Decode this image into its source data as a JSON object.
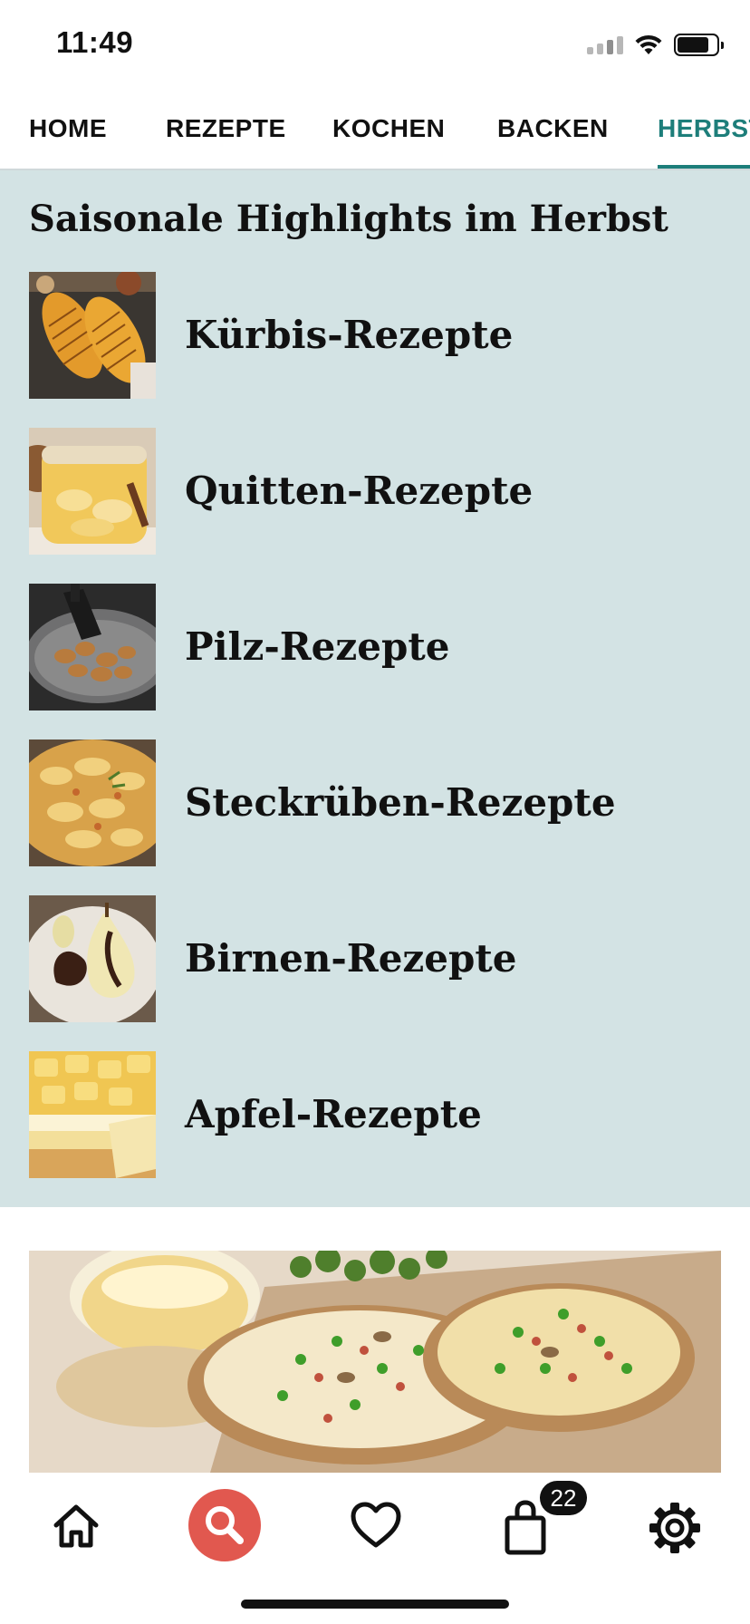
{
  "status_bar": {
    "time": "11:49"
  },
  "nav_tabs": [
    {
      "label": "HOME"
    },
    {
      "label": "REZEPTE"
    },
    {
      "label": "KOCHEN"
    },
    {
      "label": "BACKEN"
    },
    {
      "label": "HERBST",
      "active": true
    }
  ],
  "highlights": {
    "title": "Saisonale Highlights im Herbst",
    "items": [
      {
        "label": "Kürbis-Rezepte",
        "image": "roasted-hasselback-pumpkin"
      },
      {
        "label": "Quitten-Rezepte",
        "image": "quince-compote-jar"
      },
      {
        "label": "Pilz-Rezepte",
        "image": "fried-mushrooms-pan"
      },
      {
        "label": "Steckrüben-Rezepte",
        "image": "rutabaga-gratin"
      },
      {
        "label": "Birnen-Rezepte",
        "image": "poached-pear-chocolate"
      },
      {
        "label": "Apfel-Rezepte",
        "image": "apple-cream-cake"
      }
    ]
  },
  "banner": {
    "image": "mini-flammkuchen-on-board"
  },
  "bottom_nav": {
    "items": [
      {
        "icon": "home-icon"
      },
      {
        "icon": "search-icon"
      },
      {
        "icon": "heart-icon"
      },
      {
        "icon": "shopping-bag-icon"
      },
      {
        "icon": "gear-icon"
      }
    ],
    "cart_badge": "22"
  },
  "colors": {
    "accent": "#1d7e7a",
    "highlight_bg": "#d3e3e4",
    "search_button": "#e1584f"
  }
}
